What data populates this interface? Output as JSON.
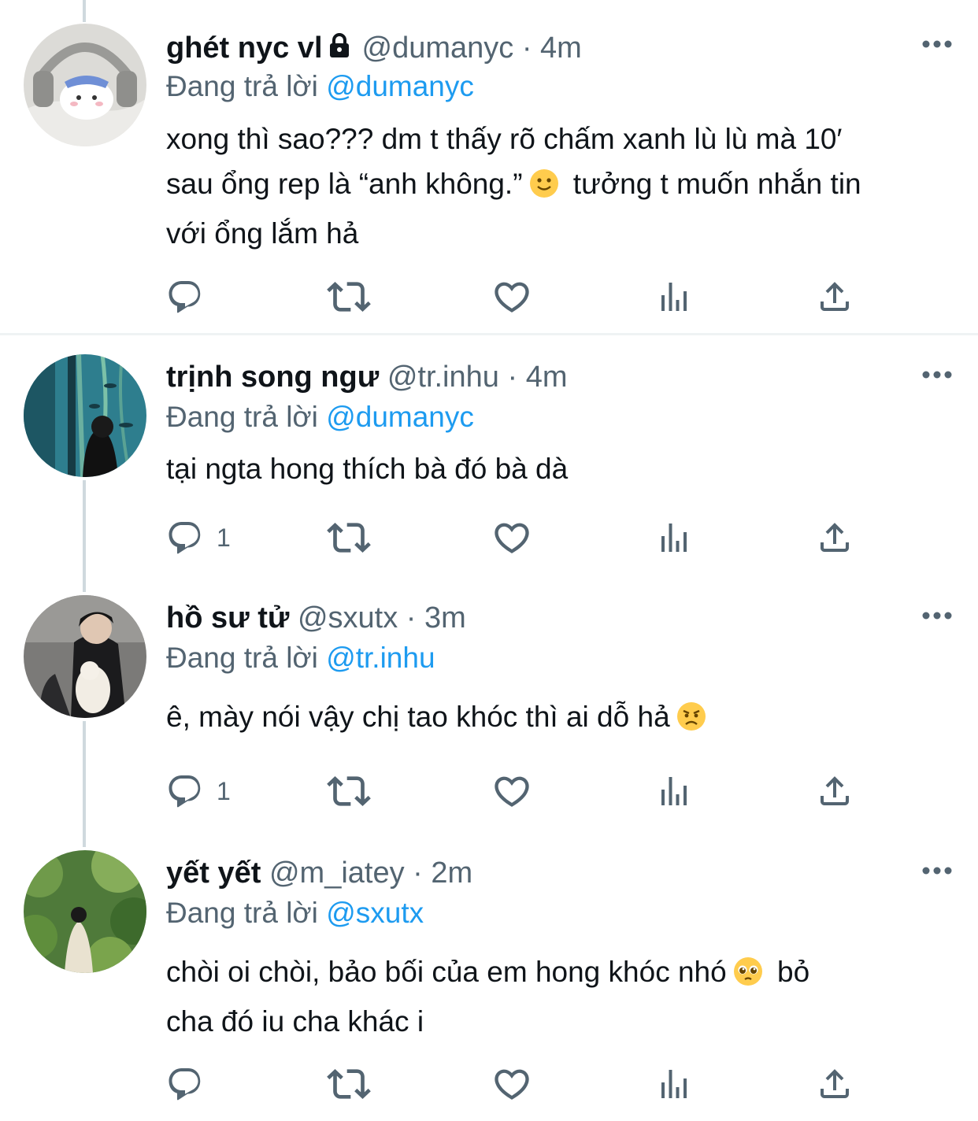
{
  "tweets": [
    {
      "name": "ghét nyc vl",
      "handle": "@dumanyc",
      "separator": "·",
      "time": "4m",
      "reply_prefix": "Đang trả lời ",
      "reply_to": "@dumanyc",
      "text_a": "xong thì sao??? dm t thấy rõ chấm xanh lù lù mà 10′\nsau ổng rep là “anh không.”",
      "emoji": "slightly-smiling-face",
      "text_b": " tưởng t muốn nhắn tin\nvới ổng lắm hả",
      "reply_count": ""
    },
    {
      "name": "trịnh song ngư",
      "handle": "@tr.inhu",
      "separator": "·",
      "time": "4m",
      "reply_prefix": "Đang trả lời ",
      "reply_to": "@dumanyc",
      "text_a": "tại ngta hong thích bà đó bà dà",
      "reply_count": "1"
    },
    {
      "name": "hồ sư tử",
      "handle": "@sxutx",
      "separator": "·",
      "time": "3m",
      "reply_prefix": "Đang trả lời ",
      "reply_to": "@tr.inhu",
      "text_a": "ê, mày nói vậy chị tao khóc thì ai dỗ hả",
      "emoji": "angry-face",
      "reply_count": "1"
    },
    {
      "name": "yết yết",
      "handle": "@m_iatey",
      "separator": "·",
      "time": "2m",
      "reply_prefix": "Đang trả lời ",
      "reply_to": "@sxutx",
      "text_a": "chòi oi chòi, bảo bối của em hong khóc nhó",
      "emoji": "pleading-face",
      "text_b": " bỏ\ncha đó iu cha khác i",
      "reply_count": ""
    }
  ],
  "icons": {
    "reply": "reply-icon",
    "retweet": "retweet-icon",
    "like": "heart-icon",
    "views": "views-icon",
    "share": "share-icon",
    "more": "more-icon",
    "lock": "lock-icon"
  },
  "colors": {
    "link": "#1d9bf0",
    "secondary": "#536471",
    "thread_line": "#cfd9de"
  }
}
